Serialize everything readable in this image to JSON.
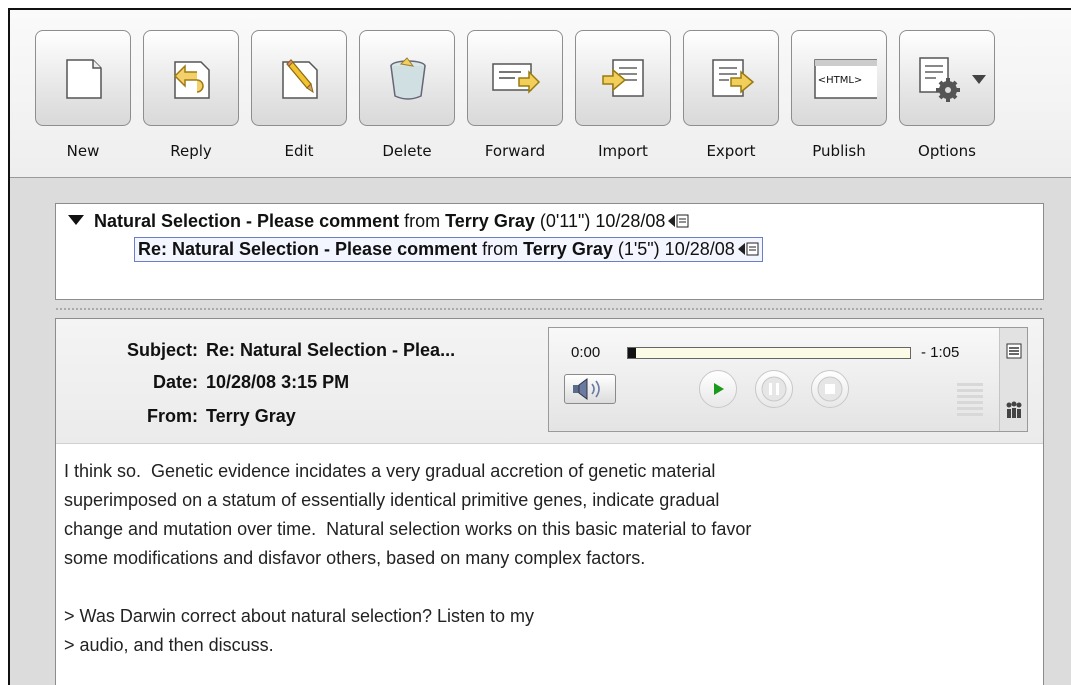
{
  "toolbar": {
    "buttons": [
      {
        "label": "New",
        "icon": "new-document-icon"
      },
      {
        "label": "Reply",
        "icon": "reply-icon"
      },
      {
        "label": "Edit",
        "icon": "edit-pencil-icon"
      },
      {
        "label": "Delete",
        "icon": "trash-icon"
      },
      {
        "label": "Forward",
        "icon": "forward-icon"
      },
      {
        "label": "Import",
        "icon": "import-icon"
      },
      {
        "label": "Export",
        "icon": "export-icon"
      },
      {
        "label": "Publish",
        "icon": "html-publish-icon",
        "icon_text": "<HTML>"
      },
      {
        "label": "Options",
        "icon": "options-gear-icon"
      }
    ]
  },
  "thread": {
    "items": [
      {
        "subject": "Natural Selection - Please comment",
        "from_word": " from ",
        "author": "Terry Gray",
        "meta": " (0'11\") 10/28/08",
        "expanded": true
      },
      {
        "subject": "Re: Natural Selection - Please comment",
        "from_word": " from ",
        "author": "Terry Gray",
        "meta": " (1'5\") 10/28/08",
        "selected": true
      }
    ]
  },
  "message": {
    "subject_label": "Subject:",
    "subject": "Re: Natural Selection - Plea...",
    "date_label": "Date:",
    "date": "10/28/08 3:15 PM",
    "from_label": "From:",
    "from": "Terry Gray",
    "body": "I think so.  Genetic evidence incidates a very gradual accretion of genetic material\nsuperimposed on a statum of essentially identical primitive genes, indicate gradual\nchange and mutation over time.  Natural selection works on this basic material to favor\nsome modifications and disfavor others, based on many complex factors.\n\n> Was Darwin correct about natural selection? Listen to my\n> audio, and then discuss."
  },
  "player": {
    "time_start": "0:00",
    "time_end": "- 1:05",
    "progress": 0.03,
    "play_color": "#1a9a1a"
  }
}
